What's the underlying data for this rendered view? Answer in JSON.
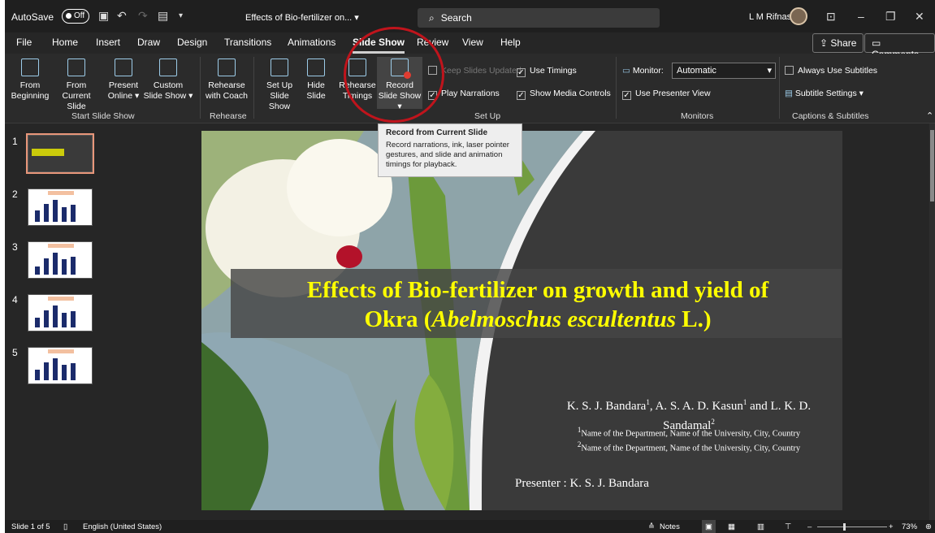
{
  "titlebar": {
    "autosave": "AutoSave",
    "toggle": "Off",
    "doc_title": "Effects of Bio-fertilizer on...  ▾",
    "search": "Search",
    "user": "L M Rifnas"
  },
  "menu": {
    "tabs": [
      "File",
      "Home",
      "Insert",
      "Draw",
      "Design",
      "Transitions",
      "Animations",
      "Slide Show",
      "Review",
      "View",
      "Help"
    ],
    "share": "Share",
    "comments": "Comments"
  },
  "ribbon": {
    "from_beginning": "From Beginning",
    "from_current": "From Current Slide",
    "present_online": "Present Online ▾",
    "custom_show": "Custom Slide Show ▾",
    "rehearse_coach": "Rehearse with Coach",
    "setup_show": "Set Up Slide Show",
    "hide_slide": "Hide Slide",
    "rehearse_timings": "Rehearse Timings",
    "record_show": "Record Slide Show ▾",
    "keep_updated": "Keep Slides Updated",
    "play_narrations": "Play Narrations",
    "use_timings": "Use Timings",
    "show_media": "Show Media Controls",
    "monitor": "Monitor:",
    "monitor_value": "Automatic",
    "presenter_view": "Use Presenter View",
    "always_subtitles": "Always Use Subtitles",
    "subtitle_settings": "Subtitle Settings ▾",
    "group_start": "Start Slide Show",
    "group_rehearse": "Rehearse",
    "group_setup": "Set Up",
    "group_monitors": "Monitors",
    "group_captions": "Captions & Subtitles"
  },
  "tooltip": {
    "title": "Record from Current Slide",
    "body": "Record narrations, ink, laser pointer gestures, and slide and animation timings for playback."
  },
  "thumbnails": [
    "1",
    "2",
    "3",
    "4",
    "5"
  ],
  "slide": {
    "title_line1": "Effects of Bio-fertilizer on growth and yield of",
    "title_line2a": "Okra (",
    "title_line2b": "Abelmoschus escultentus",
    "title_line2c": " L.)",
    "author1": "K. S. J. Bandara",
    "author2": ", A. S. A. D. Kasun",
    "author3": " and L. K. D.",
    "author4": "Sandamal",
    "sup1": "1",
    "sup2": "1",
    "sup3": "2",
    "aff1": "Name of the Department, Name of the University, City, Country",
    "aff2": "Name of the Department, Name of the University, City, Country",
    "presenter": "Presenter : K. S. J. Bandara"
  },
  "status": {
    "slide": "Slide 1 of 5",
    "lang": "English (United States)",
    "notes": "Notes",
    "zoom": "73%"
  }
}
